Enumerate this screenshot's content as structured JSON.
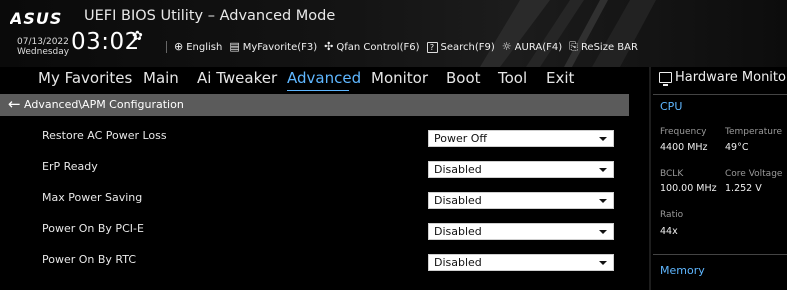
{
  "header": {
    "title": "UEFI BIOS Utility – Advanced Mode",
    "logo_text": "ASUS",
    "date": "07/13/2022",
    "weekday": "Wednesday",
    "time": "03:02",
    "toolbar": [
      {
        "label": "English",
        "icon": "globe-icon"
      },
      {
        "label": "MyFavorite(F3)",
        "icon": "favorite-icon"
      },
      {
        "label": "Qfan Control(F6)",
        "icon": "fan-icon"
      },
      {
        "label": "Search(F9)",
        "icon": "search-icon"
      },
      {
        "label": "AURA(F4)",
        "icon": "aura-icon"
      },
      {
        "label": "ReSize BAR",
        "icon": "resize-bar-icon"
      }
    ]
  },
  "menu": {
    "items": [
      "My Favorites",
      "Main",
      "Ai Tweaker",
      "Advanced",
      "Monitor",
      "Boot",
      "Tool",
      "Exit"
    ],
    "active": "Advanced"
  },
  "breadcrumb": {
    "text": "Advanced\\APM Configuration"
  },
  "settings": [
    {
      "label": "Restore AC Power Loss",
      "value": "Power Off"
    },
    {
      "label": "ErP Ready",
      "value": "Disabled"
    },
    {
      "label": "Max Power Saving",
      "value": "Disabled"
    },
    {
      "label": "Power On By PCI-E",
      "value": "Disabled"
    },
    {
      "label": "Power On By RTC",
      "value": "Disabled"
    }
  ],
  "hardware_monitor": {
    "title": "Hardware Monitor",
    "cpu_section": "CPU",
    "frequency_label": "Frequency",
    "frequency_value": "4400 MHz",
    "temperature_label": "Temperature",
    "temperature_value": "49°C",
    "bclk_label": "BCLK",
    "bclk_value": "100.00 MHz",
    "core_voltage_label": "Core Voltage",
    "core_voltage_value": "1.252 V",
    "ratio_label": "Ratio",
    "ratio_value": "44x",
    "memory_section": "Memory"
  },
  "colors": {
    "accent": "#5fb7ff",
    "breadcrumb_bg": "#5b5b5b",
    "dropdown_bg": "#ffffff"
  }
}
